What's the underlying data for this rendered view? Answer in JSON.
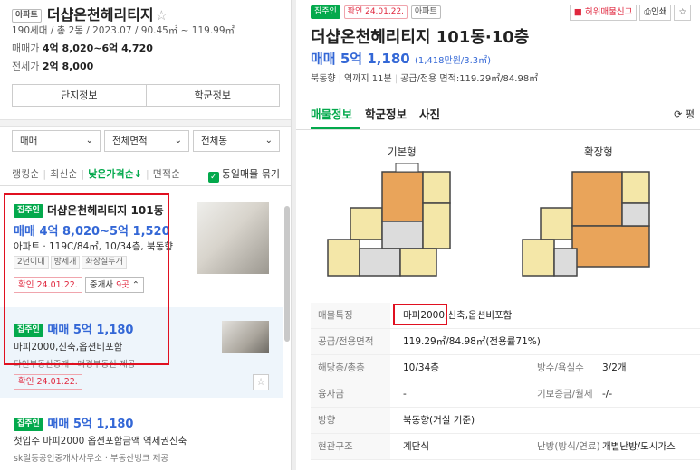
{
  "complex": {
    "type_tag": "아파트",
    "name": "더샵온천헤리티지",
    "summary": "190세대 / 총 2동 / 2023.07 / 90.45㎡ ~ 119.99㎡",
    "sale_label": "매매가",
    "sale_value": "4억 8,020~6억 4,720",
    "jeonse_label": "전세가",
    "jeonse_value": "2억 8,000",
    "btn_info": "단지정보",
    "btn_school": "학군정보"
  },
  "filters": {
    "trade": "매매",
    "area": "전체면적",
    "dong": "전체동"
  },
  "sort": {
    "ranking": "랭킹순",
    "latest": "최신순",
    "low_price": "낮은가격순↓",
    "area": "면적순",
    "same_group": "동일매물 묶기"
  },
  "listings": [
    {
      "badge": "집주인",
      "title": "더샵온천헤리티지 101동",
      "price": "매매 4억 8,020~5억 1,520",
      "desc": "아파트 · 119C/84㎡, 10/34층, 북동향",
      "chips": [
        "2년이내",
        "방세개",
        "화장실두개"
      ],
      "confirm": "확인 24.01.22.",
      "agents_prefix": "중개사 ",
      "agents_count": "9곳",
      "agents_suffix": " ⌃"
    },
    {
      "badge": "집주인",
      "price": "매매 5억 1,180",
      "desc": "마피2000,신축,옵션비포함",
      "agency": "다인부동산중개 · 매경부동산 제공",
      "confirm": "확인 24.01.22."
    },
    {
      "badge": "집주인",
      "price": "매매 5억 1,180",
      "desc": "첫입주 마피2000 옵션포함금액 역세권신축",
      "agency": "sk일등공인중개사사무소 · 부동산뱅크 제공"
    }
  ],
  "detail": {
    "badge": "집주인",
    "confirm": "확인 24.01.22.",
    "type_tag": "아파트",
    "report": "허위매물신고",
    "print": "인쇄",
    "title": "더샵온천헤리티지 101동·10층",
    "price": "매매 5억 1,180",
    "price_unit": "(1,418만원/3.3㎡)",
    "direction": "북동향",
    "station": "역까지 11분",
    "area": "공급/전용 면적:119.29㎡/84.98㎡",
    "tabs": [
      "매물정보",
      "학군정보",
      "사진"
    ],
    "pyeong": "평",
    "plan_basic": "기본형",
    "plan_ext": "확장형",
    "rows": [
      {
        "k": "매물특징",
        "v": "마피2000,신축,옵션비포함"
      },
      {
        "k": "공급/전용면적",
        "v": "119.29㎡/84.98㎡(전용률71%)"
      },
      {
        "k": "해당층/총층",
        "v": "10/34층",
        "k2": "방수/욕실수",
        "v2": "3/2개"
      },
      {
        "k": "융자금",
        "v": "-",
        "k2": "기보증금/월세",
        "v2": "-/-"
      },
      {
        "k": "방향",
        "v": "북동향(거실 기준)"
      },
      {
        "k": "현관구조",
        "v": "계단식",
        "k2": "난방(방식/연료)",
        "v2": "개별난방/도시가스"
      }
    ]
  }
}
